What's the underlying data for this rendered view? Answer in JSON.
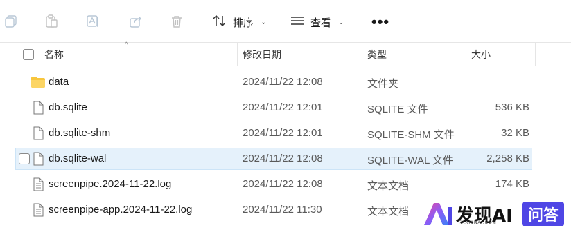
{
  "toolbar": {
    "sort_label": "排序",
    "view_label": "查看",
    "more_label": "•••"
  },
  "columns": {
    "name": "名称",
    "modified": "修改日期",
    "type": "类型",
    "size": "大小"
  },
  "files": [
    {
      "name": "data",
      "modified": "2024/11/22 12:08",
      "type": "文件夹",
      "size": "",
      "icon": "folder-icon"
    },
    {
      "name": "db.sqlite",
      "modified": "2024/11/22 12:01",
      "type": "SQLITE 文件",
      "size": "536 KB",
      "icon": "file-icon"
    },
    {
      "name": "db.sqlite-shm",
      "modified": "2024/11/22 12:01",
      "type": "SQLITE-SHM 文件",
      "size": "32 KB",
      "icon": "file-icon"
    },
    {
      "name": "db.sqlite-wal",
      "modified": "2024/11/22 12:08",
      "type": "SQLITE-WAL 文件",
      "size": "2,258 KB",
      "icon": "file-icon",
      "selected": true
    },
    {
      "name": "screenpipe.2024-11-22.log",
      "modified": "2024/11/22 12:08",
      "type": "文本文档",
      "size": "174 KB",
      "icon": "text-file-icon"
    },
    {
      "name": "screenpipe-app.2024-11-22.log",
      "modified": "2024/11/22 11:30",
      "type": "文本文档",
      "size": "",
      "icon": "text-file-icon"
    }
  ],
  "watermark": {
    "brand": "发现AI",
    "sub": "FAXIANAI.COM",
    "badge": "问答"
  },
  "colors": {
    "folder": "#f8c63d",
    "selection": "#e5f1fb",
    "watermark_accent": "#4f46e5"
  }
}
